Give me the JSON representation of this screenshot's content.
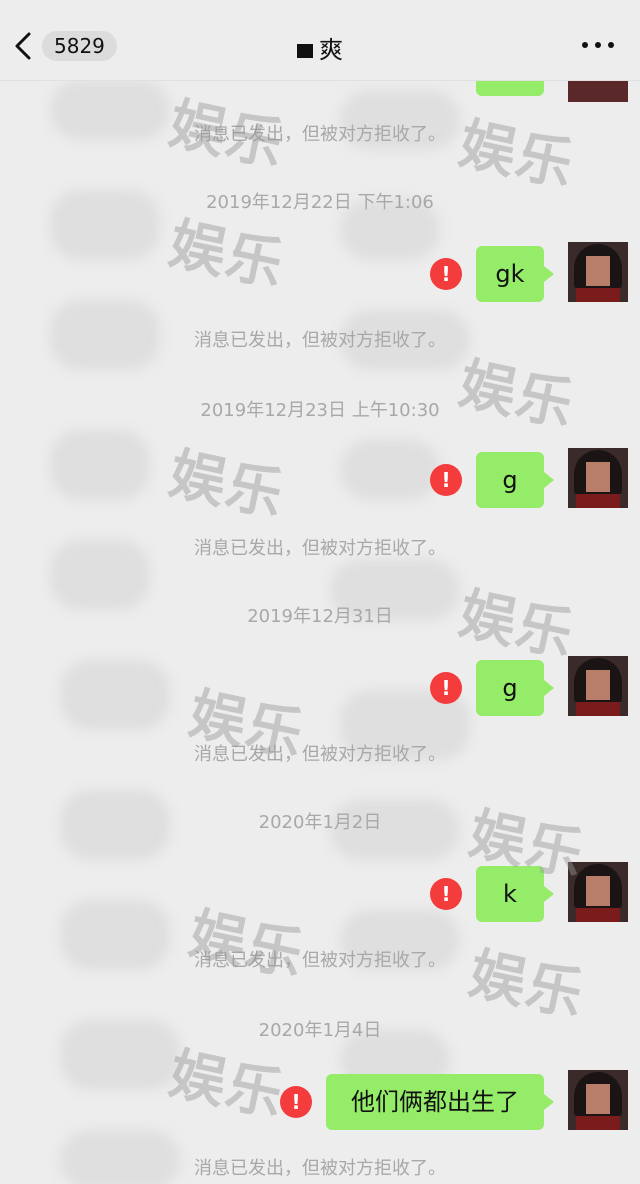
{
  "header": {
    "unread_count": "5829",
    "title": "爽"
  },
  "messages": [
    {
      "timestamp": "2019年12月22日 下午1:06",
      "text": "gk",
      "notice": "消息已发出，但被对方拒收了。"
    },
    {
      "timestamp": "2019年12月23日 上午10:30",
      "text": "g",
      "notice": "消息已发出，但被对方拒收了。"
    },
    {
      "timestamp": "2019年12月31日",
      "text": "g",
      "notice": "消息已发出，但被对方拒收了。"
    },
    {
      "timestamp": "2020年1月2日",
      "text": "k",
      "notice": "消息已发出，但被对方拒收了。"
    },
    {
      "timestamp": "2020年1月4日",
      "text": "他们俩都出生了",
      "notice": "消息已发出，但被对方拒收了。"
    }
  ],
  "top_notice": "消息已发出，但被对方拒收了。",
  "watermark": "娱乐",
  "error_glyph": "!",
  "colors": {
    "bubble": "#95ec69",
    "background": "#ededed",
    "error": "#f43c3c"
  }
}
